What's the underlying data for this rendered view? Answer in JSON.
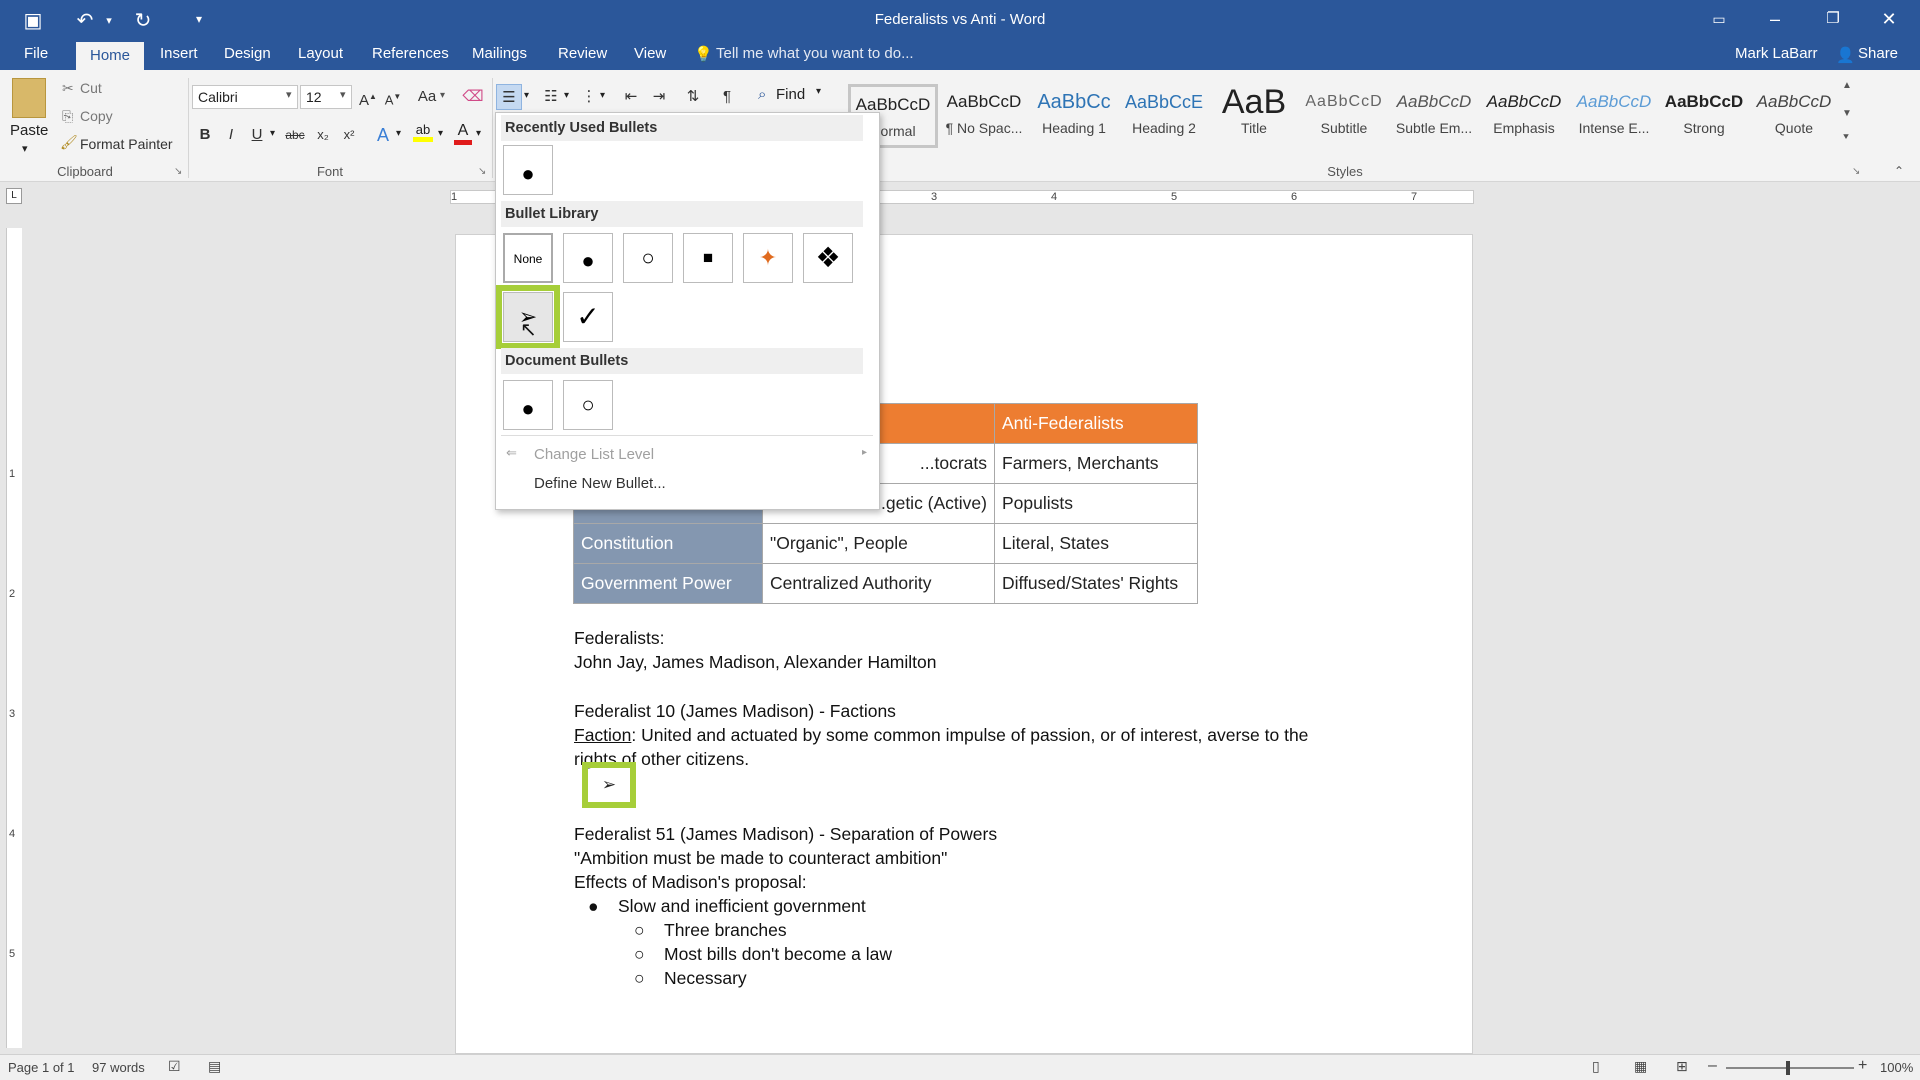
{
  "window": {
    "title": "Federalists vs Anti - Word",
    "qat_icons": [
      "save-icon",
      "undo-icon",
      "redo-icon",
      "customize-icon"
    ]
  },
  "tabs": [
    "File",
    "Home",
    "Insert",
    "Design",
    "Layout",
    "References",
    "Mailings",
    "Review",
    "View"
  ],
  "active_tab": "Home",
  "tell_me": "Tell me what you want to do...",
  "user": {
    "name": "Mark LaBarr",
    "share": "Share"
  },
  "clipboard": {
    "paste": "Paste",
    "cut": "Cut",
    "copy": "Copy",
    "format_painter": "Format Painter",
    "label": "Clipboard"
  },
  "font": {
    "name": "Calibri",
    "size": "12",
    "label": "Font",
    "change_case": "Aa"
  },
  "editing": {
    "find": "Find"
  },
  "styles": {
    "label": "Styles",
    "items": [
      {
        "sample": "AaBbCcD",
        "name": "Normal"
      },
      {
        "sample": "AaBbCcD",
        "name": "¶ No Spac..."
      },
      {
        "sample": "AaBbCc",
        "name": "Heading 1"
      },
      {
        "sample": "AaBbCcE",
        "name": "Heading 2"
      },
      {
        "sample": "AaB",
        "name": "Title"
      },
      {
        "sample": "AaBbCcD",
        "name": "Subtitle"
      },
      {
        "sample": "AaBbCcD",
        "name": "Subtle Em..."
      },
      {
        "sample": "AaBbCcD",
        "name": "Emphasis"
      },
      {
        "sample": "AaBbCcD",
        "name": "Intense E..."
      },
      {
        "sample": "AaBbCcD",
        "name": "Strong"
      },
      {
        "sample": "AaBbCcD",
        "name": "Quote"
      }
    ]
  },
  "ruler_numbers": [
    "1",
    "3",
    "4",
    "5",
    "6",
    "7"
  ],
  "vruler_numbers": [
    "1",
    "2",
    "3",
    "4",
    "5"
  ],
  "bullet_menu": {
    "recent_header": "Recently Used Bullets",
    "library_header": "Bullet Library",
    "document_header": "Document Bullets",
    "none_label": "None",
    "change_list_level": "Change List Level",
    "define_new_bullet": "Define New Bullet...",
    "recent_bullets": [
      "●"
    ],
    "library_bullets": [
      "●",
      "○",
      "■",
      "✦",
      "❖",
      "➢",
      "✓"
    ],
    "document_bullets": [
      "●",
      "○"
    ]
  },
  "table": {
    "header": [
      "",
      "",
      "Anti-Federalists"
    ],
    "rows": [
      [
        "",
        "...tocrats",
        "Farmers, Merchants"
      ],
      [
        "",
        "...getic (Active)",
        "Populists"
      ],
      [
        "Constitution",
        "\"Organic\", People",
        "Literal, States"
      ],
      [
        "Government Power",
        "Centralized Authority",
        "Diffused/States' Rights"
      ]
    ]
  },
  "doc": {
    "l1": "Federalists:",
    "l2": "John Jay, James Madison, Alexander Hamilton",
    "l3": "Federalist 10 (James Madison) - Factions",
    "l4_term": "Faction",
    "l4_rest": ": United and actuated by some common impulse of passion, or of interest, averse to the",
    "l5": "rights of other citizens.",
    "new_bullet": "➢",
    "l6": "Federalist 51 (James Madison) - Separation of Powers",
    "l7": "\"Ambition must be made to counteract ambition\"",
    "l8": "Effects of Madison's proposal:",
    "b1": "Slow and inefficient government",
    "b1_1": "Three branches",
    "b1_2": "Most bills don't become a law",
    "b1_3": "Necessary"
  },
  "status": {
    "page": "Page 1 of 1",
    "words": "97 words",
    "zoom": "100%"
  },
  "colors": {
    "accent": "#2b579a",
    "table_header": "#ed7d31",
    "row_header": "#8497b0",
    "highlight": "#a6ce39"
  }
}
